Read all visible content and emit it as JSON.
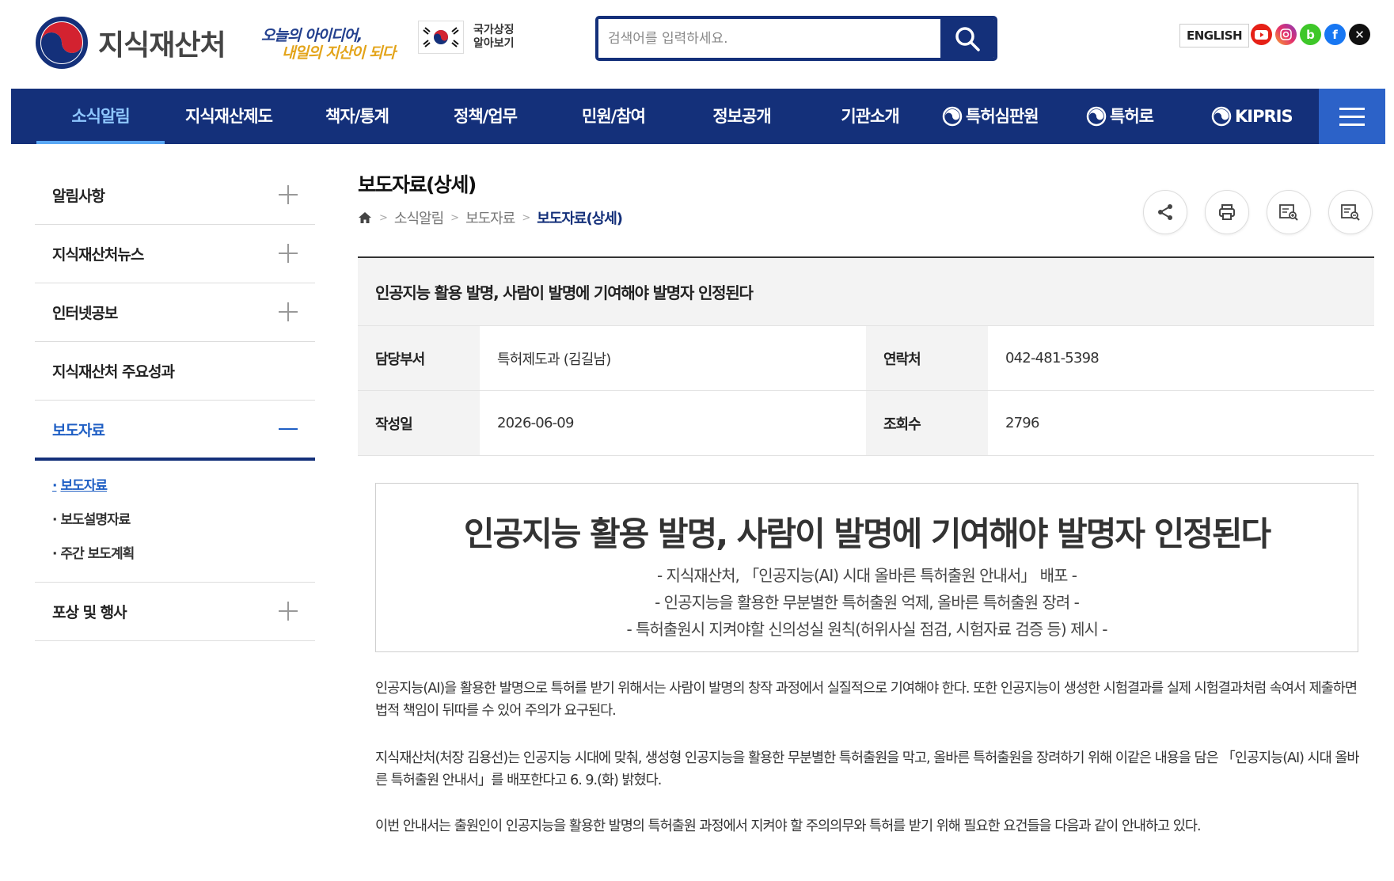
{
  "header": {
    "logo_text": "지식재산처",
    "slogan_line1": "오늘의 아이디어,",
    "slogan_line2": "내일의 지산이 되다",
    "national_symbols_label": "국가상징 알아보기",
    "search_placeholder": "검색어를 입력하세요.",
    "english_label": "ENGLISH",
    "social": [
      "youtube-icon",
      "instagram-icon",
      "blog-icon",
      "facebook-icon",
      "x-icon"
    ]
  },
  "nav": {
    "items": [
      "소식알림",
      "지식재산제도",
      "책자/통계",
      "정책/업무",
      "민원/참여",
      "정보공개",
      "기관소개"
    ],
    "external": [
      "특허심판원",
      "특허로",
      "KIPRIS"
    ],
    "active_index": 0
  },
  "sidebar": {
    "items": [
      "알림사항",
      "지식재산처뉴스",
      "인터넷공보",
      "지식재산처 주요성과",
      "보도자료",
      "포상 및 행사"
    ],
    "active": "보도자료",
    "sub_items": [
      "보도자료",
      "보도설명자료",
      "주간 보도계획"
    ],
    "active_sub": "보도자료"
  },
  "page": {
    "title": "보도자료(상세)",
    "breadcrumb": [
      "소식알림",
      "보도자료",
      "보도자료(상세)"
    ]
  },
  "detail": {
    "title": "인공지능 활용 발명, 사람이 발명에 기여해야 발명자 인정된다",
    "dept_label": "담당부서",
    "dept_value": "특허제도과 (김길남)",
    "contact_label": "연락처",
    "contact_value": "042-481-5398",
    "date_label": "작성일",
    "date_value": "2026-06-09",
    "views_label": "조회수",
    "views_value": "2796"
  },
  "article": {
    "headline": "인공지능 활용 발명, 사람이 발명에 기여해야 발명자 인정된다",
    "subheads": [
      "- 지식재산처, 「인공지능(AI) 시대 올바른 특허출원 안내서」 배포 -",
      "- 인공지능을 활용한 무분별한 특허출원 억제, 올바른 특허출원 장려 -",
      "- 특허출원시 지켜야할 신의성실 원칙(허위사실 점검, 시험자료 검증 등) 제시 -"
    ],
    "paragraphs": [
      "인공지능(AI)을 활용한 발명으로 특허를 받기 위해서는 사람이 발명의 창작 과정에서 실질적으로 기여해야 한다. 또한 인공지능이 생성한 시험결과를 실제 시험결과처럼 속여서 제출하면 법적 책임이 뒤따를 수 있어 주의가 요구된다.",
      "지식재산처(처장 김용선)는 인공지능 시대에 맞춰, 생성형 인공지능을 활용한 무분별한 특허출원을 막고, 올바른 특허출원을 장려하기 위해 이같은 내용을 담은 「인공지능(AI) 시대 올바른 특허출원 안내서」를 배포한다고 6. 9.(화) 밝혔다.",
      "이번 안내서는 출원인이 인공지능을 활용한 발명의 특허출원 과정에서 지켜야 할 주의의무와 특허를 받기 위해 필요한 요건들을 다음과 같이 안내하고 있다."
    ]
  },
  "colors": {
    "primary": "#14307a",
    "accent": "#1f5fc4",
    "nav_active": "#8ec6ff"
  }
}
